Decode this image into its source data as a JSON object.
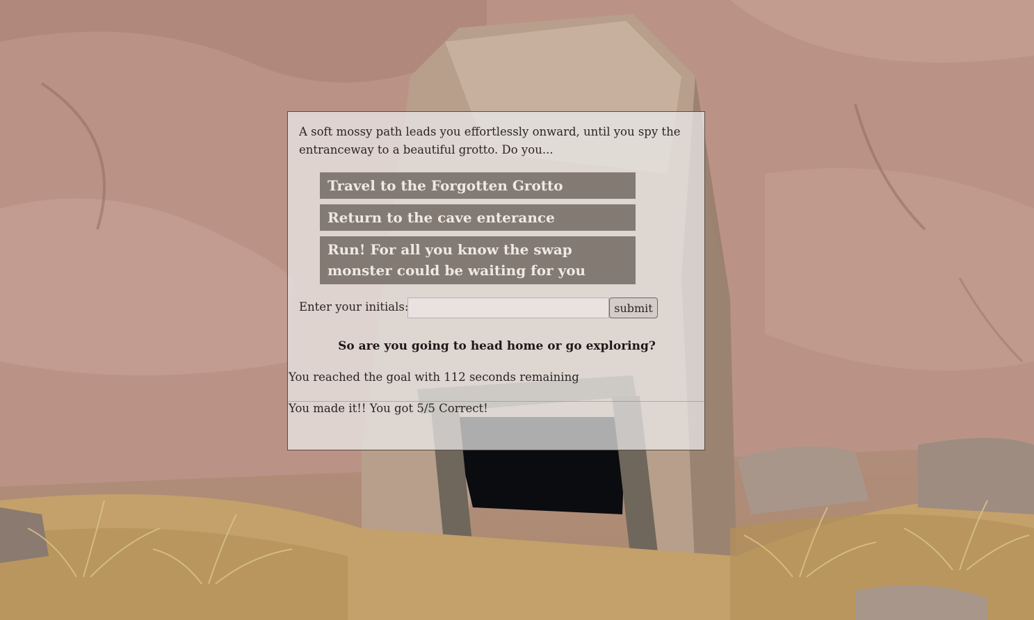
{
  "scene": {
    "description_icon": "cave-entrance-background"
  },
  "prompt": {
    "text": "A soft mossy path leads you effortlessly onward, until you spy the entranceway to a beautiful grotto. Do you..."
  },
  "choices": [
    {
      "label": "Travel to the Forgotten Grotto"
    },
    {
      "label": "Return to the cave enterance"
    },
    {
      "label": "Run! For all you know the swap monster could be waiting for you"
    }
  ],
  "initials": {
    "label": "Enter your initials:",
    "value": "",
    "placeholder": "",
    "submit_label": "submit"
  },
  "question": {
    "text": "So are you going to head home or go exploring?"
  },
  "status": {
    "goal_text": "You reached the goal with 112 seconds remaining",
    "result_text": "You made it!! You got 5/5 Correct!"
  },
  "colors": {
    "panel_bg": "#ececec",
    "choice_bg": "#736a64",
    "choice_text": "#efe8e3",
    "rock": "#b38d7f",
    "sand": "#c4a06a"
  }
}
